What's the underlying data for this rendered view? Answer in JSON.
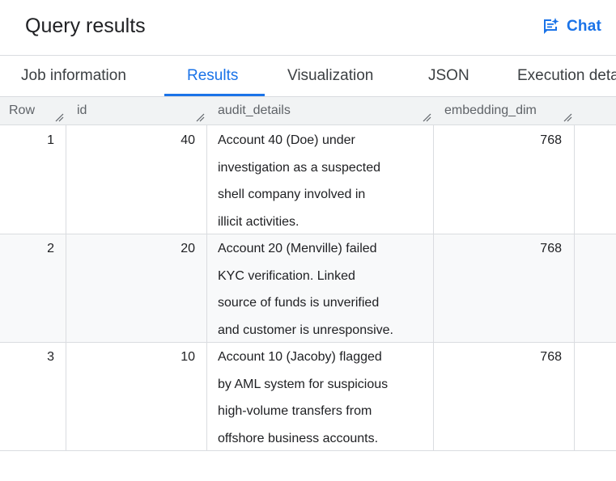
{
  "header": {
    "title": "Query results",
    "chat_label": "Chat",
    "chat_icon": "chat-spark-icon",
    "accent_color": "#1a73e8"
  },
  "tabs": [
    {
      "label": "Job information",
      "active": false
    },
    {
      "label": "Results",
      "active": true
    },
    {
      "label": "Visualization",
      "active": false
    },
    {
      "label": "JSON",
      "active": false
    },
    {
      "label": "Execution details",
      "active": false
    }
  ],
  "table": {
    "columns": [
      "Row",
      "id",
      "audit_details",
      "embedding_dim"
    ],
    "rows": [
      {
        "row": "1",
        "id": "40",
        "audit_lines": [
          "Account 40 (Doe) under",
          "investigation as a suspected",
          "shell company involved in",
          "illicit activities."
        ],
        "embedding_dim": "768"
      },
      {
        "row": "2",
        "id": "20",
        "audit_lines": [
          "Account 20 (Menville) failed",
          "KYC verification. Linked",
          "source of funds is unverified",
          "and customer is unresponsive."
        ],
        "embedding_dim": "768"
      },
      {
        "row": "3",
        "id": "10",
        "audit_lines": [
          "Account 10 (Jacoby) flagged",
          "by AML system for suspicious",
          "high-volume transfers from",
          "offshore business accounts."
        ],
        "embedding_dim": "768"
      }
    ]
  }
}
